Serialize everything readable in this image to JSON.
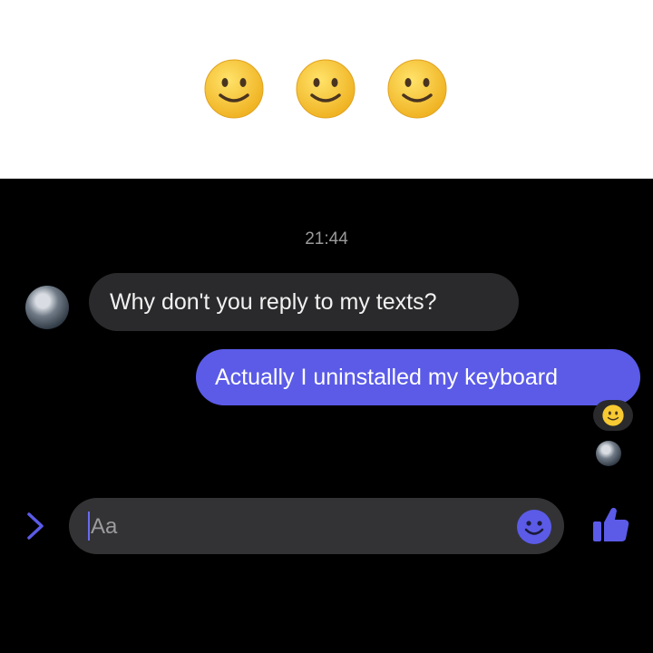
{
  "header": {
    "emojis": [
      "slightly-smiling-face",
      "slightly-smiling-face",
      "slightly-smiling-face"
    ]
  },
  "chat": {
    "timestamp": "21:44",
    "messages": [
      {
        "direction": "incoming",
        "text": "Why don't you reply to my texts?"
      },
      {
        "direction": "outgoing",
        "text": "Actually I uninstalled my keyboard",
        "reaction": "slightly-smiling-face"
      }
    ]
  },
  "composer": {
    "placeholder": "Aa",
    "expand_icon": "chevron-right-icon",
    "emoji_icon": "smiley-icon",
    "like_icon": "thumbs-up-icon"
  },
  "colors": {
    "accent": "#5b5be8",
    "incoming_bubble": "#2a2a2c",
    "background": "#000000",
    "emoji_yellow": "#f7c932"
  }
}
